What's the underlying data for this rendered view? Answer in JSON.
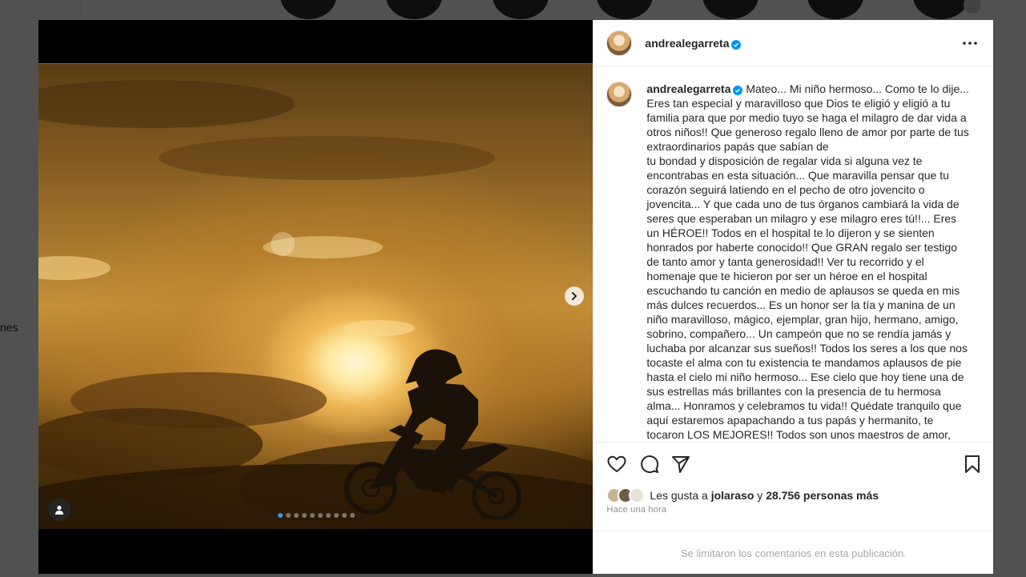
{
  "background": {
    "side_text": "nes"
  },
  "post": {
    "username": "andrealegarreta",
    "verified": true,
    "caption": "Mateo... Mi niño hermoso... Como te lo dije... Eres tan especial y maravilloso que Dios te eligió y eligió a tu familia para que por medio tuyo se haga el milagro de dar vida a otros niños!! Que generoso regalo lleno de amor por parte de tus extraordinarios papás que sabían de\ntu bondad y disposición de regalar vida si alguna vez te encontrabas en esta situación... Que maravilla pensar que tu corazón seguirá latiendo en el pecho de otro jovencito o jovencita... Y que cada uno de tus órganos cambiará la vida de seres que esperaban un milagro y ese milagro eres tú!!... Eres un HÉROE!! Todos en el hospital te lo dijeron y se sienten honrados por haberte conocido!! Que GRAN regalo ser testigo de tanto amor y tanta generosidad!! Ver tu recorrido y el homenaje que te hicieron por ser un héroe en el hospital escuchando tu canción en medio de aplausos se queda en mis más dulces recuerdos... Es un honor ser la tía y manina de un niño maravilloso, mágico, ejemplar, gran hijo, hermano, amigo, sobrino, compañero... Un campeón que no se rendía jamás y luchaba por alcanzar sus sueños!! Todos los seres a los que nos tocaste el alma con tu existencia te mandamos aplausos de pie hasta el cielo mi niño hermoso... Ese cielo que hoy tiene una de sus estrellas más brillantes con la presencia de tu hermosa alma... Honramos y celebramos tu vida!! Quédate tranquilo que aquí estaremos apapachando a tus papás y hermanito, te tocaron LOS MEJORES!! Todos son unos maestros de amor, unión, lucha y",
    "likes_prefix": "Les gusta a",
    "likes_user": "jolaraso",
    "likes_connector": "y",
    "likes_others": "28.756 personas más",
    "time": "Hace una hora",
    "comments_limited": "Se limitaron los comentarios en esta publicación."
  },
  "carousel": {
    "total": 10,
    "current": 1
  },
  "icons": {
    "more": "more-options-icon",
    "like": "heart-icon",
    "comment": "comment-icon",
    "share": "send-icon",
    "save": "bookmark-icon",
    "next": "chevron-right-icon",
    "tag": "user-tag-icon"
  },
  "colors": {
    "verified": "#0095f6",
    "carousel_active": "#3897f0",
    "text": "#262626",
    "secondary": "#8e8e8e"
  }
}
